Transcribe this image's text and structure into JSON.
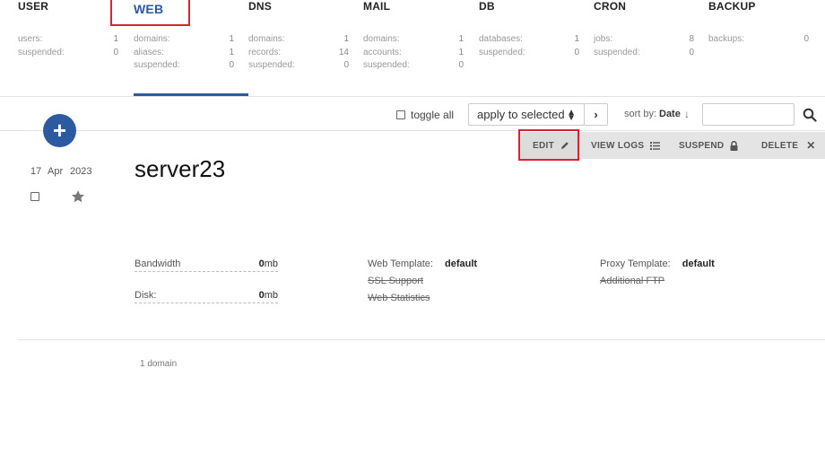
{
  "tabs": [
    {
      "name": "USER",
      "stats": [
        {
          "k": "users:",
          "v": "1"
        },
        {
          "k": "suspended:",
          "v": "0"
        }
      ]
    },
    {
      "name": "WEB",
      "stats": [
        {
          "k": "domains:",
          "v": "1"
        },
        {
          "k": "aliases:",
          "v": "1"
        },
        {
          "k": "suspended:",
          "v": "0"
        }
      ]
    },
    {
      "name": "DNS",
      "stats": [
        {
          "k": "domains:",
          "v": "1"
        },
        {
          "k": "records:",
          "v": "14"
        },
        {
          "k": "suspended:",
          "v": "0"
        }
      ]
    },
    {
      "name": "MAIL",
      "stats": [
        {
          "k": "domains:",
          "v": "1"
        },
        {
          "k": "accounts:",
          "v": "1"
        },
        {
          "k": "suspended:",
          "v": "0"
        }
      ]
    },
    {
      "name": "DB",
      "stats": [
        {
          "k": "databases:",
          "v": "1"
        },
        {
          "k": "suspended:",
          "v": "0"
        }
      ]
    },
    {
      "name": "CRON",
      "stats": [
        {
          "k": "jobs:",
          "v": "8"
        },
        {
          "k": "suspended:",
          "v": "0"
        }
      ]
    },
    {
      "name": "BACKUP",
      "stats": [
        {
          "k": "backups:",
          "v": "0"
        }
      ]
    }
  ],
  "toolbar": {
    "toggle_all": "toggle all",
    "apply_selected": "apply to selected",
    "sort_label": "sort by:",
    "sort_value": "Date",
    "search_value": ""
  },
  "actions": {
    "edit": "EDIT",
    "view_logs": "VIEW LOGS",
    "suspend": "SUSPEND",
    "delete": "DELETE"
  },
  "record": {
    "date_day": "17",
    "date_month": "Apr",
    "date_year": "2023",
    "domain": "server23",
    "bandwidth_label": "Bandwidth",
    "bandwidth_value": "0",
    "bandwidth_unit": "mb",
    "disk_label": "Disk:",
    "disk_value": "0",
    "disk_unit": "mb",
    "web_template_label": "Web Template:",
    "web_template_value": "default",
    "ssl_support": "SSL Support",
    "web_statistics": "Web Statistics",
    "proxy_template_label": "Proxy Template:",
    "proxy_template_value": "default",
    "additional_ftp": "Additional FTP"
  },
  "footer": {
    "count": "1 domain"
  },
  "colors": {
    "accent": "#2c5aa0",
    "highlight": "#d9232e"
  }
}
